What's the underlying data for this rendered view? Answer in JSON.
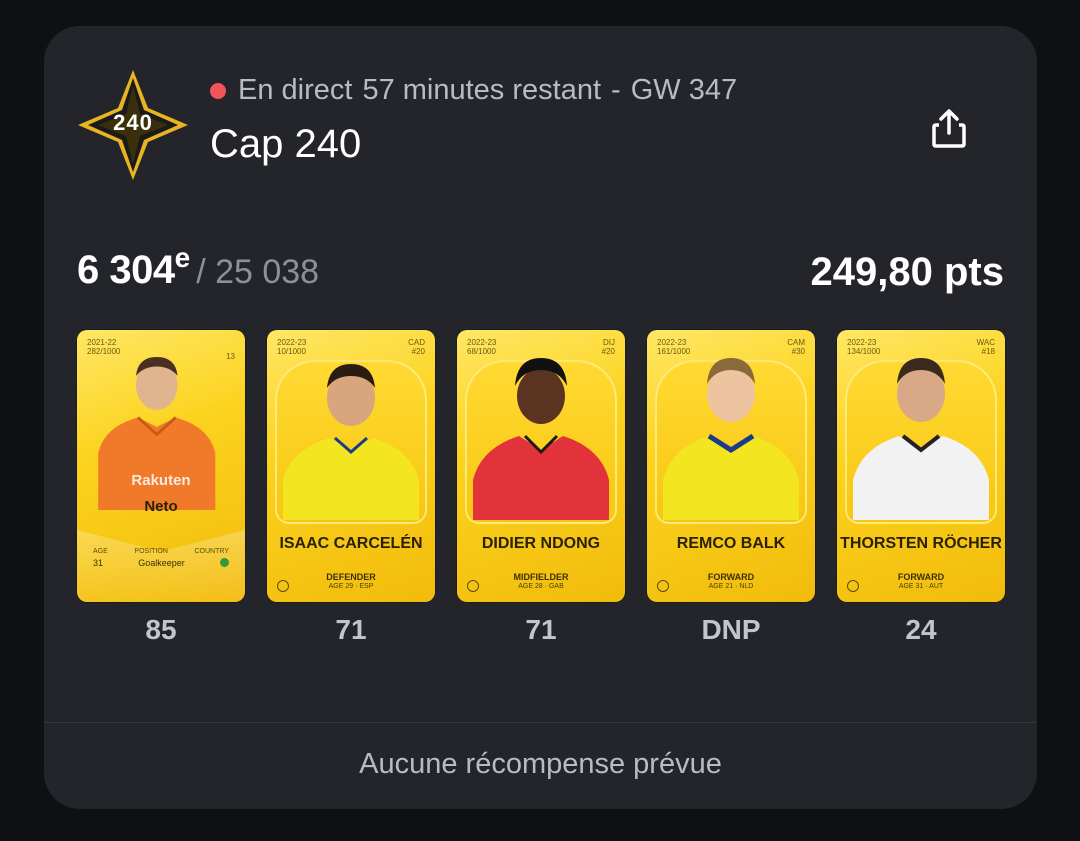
{
  "header": {
    "badge_text": "240",
    "live_label": "En direct",
    "minutes_label": "57 minutes restant",
    "separator": "-",
    "gameweek": "GW 347",
    "title": "Cap 240"
  },
  "summary": {
    "rank": "6 304",
    "rank_suffix": "e",
    "rank_total": "/ 25 038",
    "points": "249,80 pts"
  },
  "players": [
    {
      "name": "Neto",
      "season": "2021-22",
      "serial": "282/1000",
      "club": "",
      "shirt": "13",
      "position": "Goalkeeper",
      "age": "31",
      "age_label": "AGE",
      "position_label": "POSITION",
      "country_label": "COUNTRY",
      "sponsor": "Rakuten",
      "score": "85",
      "kit_color": "#f07a2a"
    },
    {
      "name": "ISAAC CARCELÉN",
      "season": "2022-23",
      "serial": "10/1000",
      "club": "CAD",
      "shirt": "#20",
      "position": "DEFENDER",
      "age": "AGE 29 · ESP",
      "score": "71",
      "kit_color": "#f4e521"
    },
    {
      "name": "DIDIER NDONG",
      "season": "2022-23",
      "serial": "68/1000",
      "club": "DIJ",
      "shirt": "#20",
      "position": "MIDFIELDER",
      "age": "AGE 28 · GAB",
      "score": "71",
      "kit_color": "#e2323a"
    },
    {
      "name": "REMCO BALK",
      "season": "2022-23",
      "serial": "161/1000",
      "club": "CAM",
      "shirt": "#30",
      "position": "FORWARD",
      "age": "AGE 21 · NLD",
      "score": "DNP",
      "kit_color": "#f4e521"
    },
    {
      "name": "THORSTEN RÖCHER",
      "season": "2022-23",
      "serial": "134/1000",
      "club": "WAC",
      "shirt": "#18",
      "position": "FORWARD",
      "age": "AGE 31 · AUT",
      "score": "24",
      "kit_color": "#f2f2f2"
    }
  ],
  "footer": {
    "rewards_label": "Aucune récompense prévue"
  },
  "colors": {
    "panel": "#23252a",
    "live_dot": "#f2545b",
    "card_gold": "#fbd31e"
  }
}
